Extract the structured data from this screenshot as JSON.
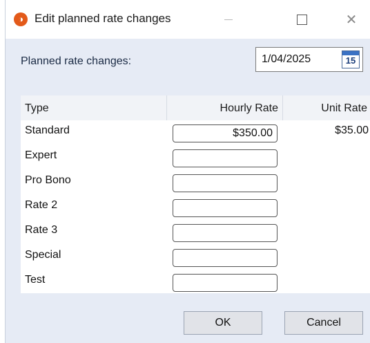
{
  "window": {
    "title": "Edit planned rate changes",
    "close_glyph": "✕",
    "accent_color": "#e35a1a"
  },
  "form": {
    "label": "Planned rate changes:",
    "date_value": "1/04/2025",
    "calendar_day": "15"
  },
  "table": {
    "headers": {
      "type": "Type",
      "hourly": "Hourly Rate",
      "unit": "Unit Rate"
    },
    "rows": [
      {
        "type": "Standard",
        "hourly": "$350.00",
        "unit": "$35.00"
      },
      {
        "type": "Expert",
        "hourly": "",
        "unit": ""
      },
      {
        "type": "Pro Bono",
        "hourly": "",
        "unit": ""
      },
      {
        "type": "Rate 2",
        "hourly": "",
        "unit": ""
      },
      {
        "type": "Rate 3",
        "hourly": "",
        "unit": ""
      },
      {
        "type": "Special",
        "hourly": "",
        "unit": ""
      },
      {
        "type": "Test",
        "hourly": "",
        "unit": ""
      }
    ]
  },
  "buttons": {
    "ok": "OK",
    "cancel": "Cancel"
  }
}
